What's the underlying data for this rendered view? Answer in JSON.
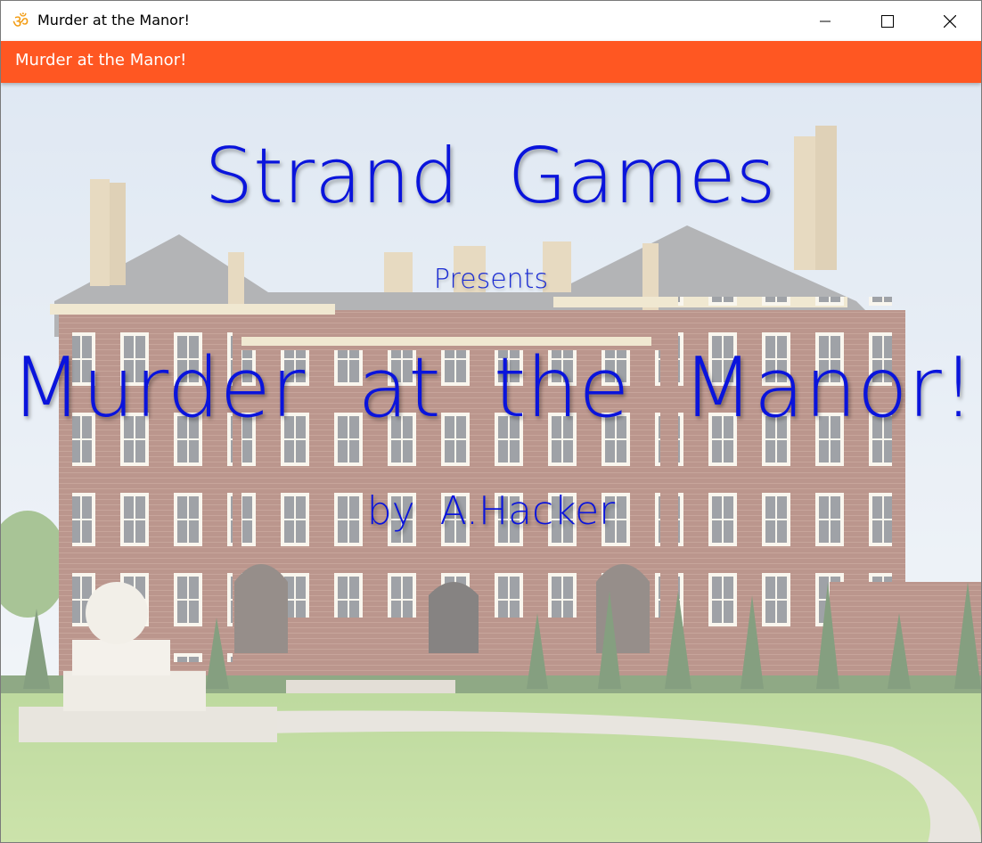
{
  "window": {
    "title": "Murder at the Manor!",
    "icon": "om-symbol-icon",
    "controls": {
      "minimize": "minimize-icon",
      "maximize": "maximize-icon",
      "close": "close-icon"
    }
  },
  "appbar": {
    "title": "Murder at the Manor!",
    "color": "#ff5722"
  },
  "splash": {
    "studio": "Strand  Games",
    "presents": "Presents",
    "game_title": "Murder  at  the  Manor!",
    "author": "by  A.Hacker",
    "text_color": "#0a14dc"
  }
}
